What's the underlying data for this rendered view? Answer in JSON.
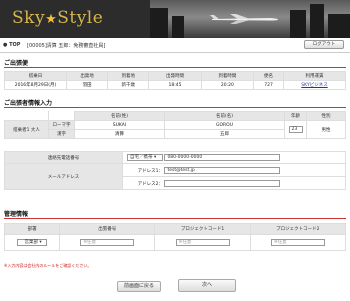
{
  "header": {
    "logo_left": "Sky",
    "logo_star": "★",
    "logo_right": "Style"
  },
  "nav": {
    "top_label": "TOP",
    "user_info": "[00005]清算 五郎：免務審査社員]",
    "logout": "ログアウト"
  },
  "flight_section": {
    "title": "ご出張便",
    "headers": [
      "搭乗日",
      "出発地",
      "到着地",
      "出発時間",
      "到着時間",
      "便名",
      "利用運賃"
    ],
    "row": [
      "2016年8月29日(月)",
      "羽田",
      "新千歳",
      "18:45",
      "20:20",
      "727",
      "SKYビジネス"
    ]
  },
  "traveler_section": {
    "title": "ご出張者情報入力",
    "col_headers": [
      "名前(姓)",
      "名前(名)",
      "年齢",
      "性別"
    ],
    "traveler_label": "搭乗者1 大人",
    "romaji_label": "ローマ字",
    "kanji_label": "漢字",
    "romaji_last": "SUKAI",
    "romaji_first": "GOROU",
    "kanji_last": "清算",
    "kanji_first": "五郎",
    "age": "23",
    "gender": "男性",
    "phone_label": "連絡先電話番号",
    "phone_type": "自宅／携帯",
    "phone_value": "080-0000-0000",
    "email_label": "メールアドレス",
    "address1_label": "アドレス1：",
    "address1_value": "test@test.jp",
    "address2_label": "アドレス2：",
    "address2_value": ""
  },
  "management_section": {
    "title": "管理情報",
    "headers": [
      "部署",
      "出張番号",
      "プロジェクトコード1",
      "プロジェクトコード2"
    ],
    "dept_value": "営業部",
    "placeholder_optional": "※任意"
  },
  "note": "※入力内容は会社内のルールをご確認ください。",
  "buttons": {
    "back": "前画面に戻る",
    "next": "次へ"
  }
}
